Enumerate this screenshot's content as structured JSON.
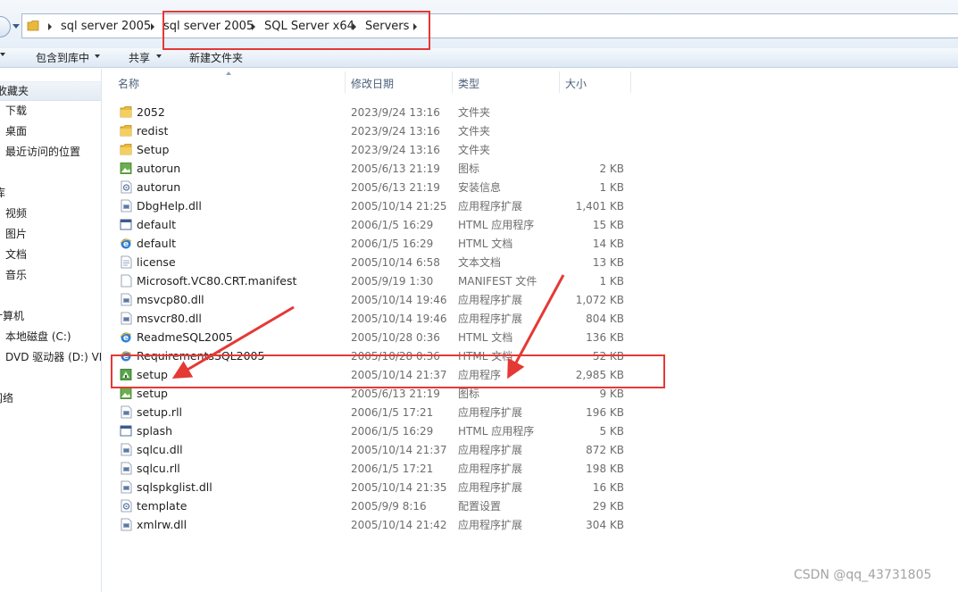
{
  "address": {
    "crumbs": [
      "sql server 2005",
      "sql server 2005",
      "SQL Server x64",
      "Servers"
    ]
  },
  "toolbar": {
    "include_library": "包含到库中",
    "share": "共享",
    "new_folder": "新建文件夹"
  },
  "nav": {
    "favorites": "收藏夹",
    "downloads": "下载",
    "desktop": "桌面",
    "recent": "最近访问的位置",
    "libraries": "库",
    "videos": "视频",
    "pictures": "图片",
    "documents": "文档",
    "music": "音乐",
    "computer": "计算机",
    "local_disk": "本地磁盘 (C:)",
    "dvd_drive": "DVD 驱动器 (D:) VI",
    "network": "网络"
  },
  "columns": {
    "name": "名称",
    "modified": "修改日期",
    "type": "类型",
    "size": "大小"
  },
  "files": [
    {
      "name": "2052",
      "date": "2023/9/24 13:16",
      "type": "文件夹",
      "size": "",
      "icon": "folder-icon"
    },
    {
      "name": "redist",
      "date": "2023/9/24 13:16",
      "type": "文件夹",
      "size": "",
      "icon": "folder-icon"
    },
    {
      "name": "Setup",
      "date": "2023/9/24 13:16",
      "type": "文件夹",
      "size": "",
      "icon": "folder-icon"
    },
    {
      "name": "autorun",
      "date": "2005/6/13 21:19",
      "type": "图标",
      "size": "2 KB",
      "icon": "image-icon"
    },
    {
      "name": "autorun",
      "date": "2005/6/13 21:19",
      "type": "安装信息",
      "size": "1 KB",
      "icon": "settings-file-icon"
    },
    {
      "name": "DbgHelp.dll",
      "date": "2005/10/14 21:25",
      "type": "应用程序扩展",
      "size": "1,401 KB",
      "icon": "dll-icon"
    },
    {
      "name": "default",
      "date": "2006/1/5 16:29",
      "type": "HTML 应用程序",
      "size": "15 KB",
      "icon": "hta-icon"
    },
    {
      "name": "default",
      "date": "2006/1/5 16:29",
      "type": "HTML 文档",
      "size": "14 KB",
      "icon": "ie-icon"
    },
    {
      "name": "license",
      "date": "2005/10/14 6:58",
      "type": "文本文档",
      "size": "13 KB",
      "icon": "text-file-icon"
    },
    {
      "name": "Microsoft.VC80.CRT.manifest",
      "date": "2005/9/19 1:30",
      "type": "MANIFEST 文件",
      "size": "1 KB",
      "icon": "blank-file-icon"
    },
    {
      "name": "msvcp80.dll",
      "date": "2005/10/14 19:46",
      "type": "应用程序扩展",
      "size": "1,072 KB",
      "icon": "dll-icon"
    },
    {
      "name": "msvcr80.dll",
      "date": "2005/10/14 19:46",
      "type": "应用程序扩展",
      "size": "804 KB",
      "icon": "dll-icon"
    },
    {
      "name": "ReadmeSQL2005",
      "date": "2005/10/28 0:36",
      "type": "HTML 文档",
      "size": "136 KB",
      "icon": "ie-icon"
    },
    {
      "name": "RequirementsSQL2005",
      "date": "2005/10/28 0:36",
      "type": "HTML 文档",
      "size": "52 KB",
      "icon": "ie-icon"
    },
    {
      "name": "setup",
      "date": "2005/10/14 21:37",
      "type": "应用程序",
      "size": "2,985 KB",
      "icon": "setup-exe-icon"
    },
    {
      "name": "setup",
      "date": "2005/6/13 21:19",
      "type": "图标",
      "size": "9 KB",
      "icon": "image-icon"
    },
    {
      "name": "setup.rll",
      "date": "2006/1/5 17:21",
      "type": "应用程序扩展",
      "size": "196 KB",
      "icon": "dll-icon"
    },
    {
      "name": "splash",
      "date": "2006/1/5 16:29",
      "type": "HTML 应用程序",
      "size": "5 KB",
      "icon": "hta-icon"
    },
    {
      "name": "sqlcu.dll",
      "date": "2005/10/14 21:37",
      "type": "应用程序扩展",
      "size": "872 KB",
      "icon": "dll-icon"
    },
    {
      "name": "sqlcu.rll",
      "date": "2006/1/5 17:21",
      "type": "应用程序扩展",
      "size": "198 KB",
      "icon": "dll-icon"
    },
    {
      "name": "sqlspkglist.dll",
      "date": "2005/10/14 21:35",
      "type": "应用程序扩展",
      "size": "16 KB",
      "icon": "dll-icon"
    },
    {
      "name": "template",
      "date": "2005/9/9 8:16",
      "type": "配置设置",
      "size": "29 KB",
      "icon": "settings-file-icon"
    },
    {
      "name": "xmlrw.dll",
      "date": "2005/10/14 21:42",
      "type": "应用程序扩展",
      "size": "304 KB",
      "icon": "dll-icon"
    }
  ],
  "watermark": "CSDN @qq_43731805",
  "colors": {
    "annotation_red": "#e53935",
    "folder_yellow": "#e8b93c"
  }
}
